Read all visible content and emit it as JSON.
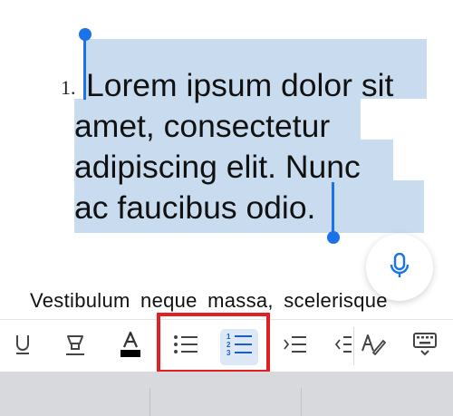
{
  "editor": {
    "list_number": "1.",
    "list_lines": [
      "Lorem ipsum dolor sit",
      "amet, consectetur",
      "adipiscing elit. Nunc",
      "ac faucibus odio."
    ],
    "paragraph": "Vestibulum neque massa, scelerisque"
  },
  "toolbar": {
    "buttons": [
      {
        "name": "underline-icon",
        "active": false
      },
      {
        "name": "highlighter-icon",
        "active": false
      },
      {
        "name": "font-color-icon",
        "active": false
      },
      {
        "name": "bulleted-list-icon",
        "active": false
      },
      {
        "name": "numbered-list-icon",
        "active": true
      },
      {
        "name": "increase-indent-icon",
        "active": false
      },
      {
        "name": "decrease-indent-icon",
        "active": false
      },
      {
        "name": "draw-icon",
        "active": false
      },
      {
        "name": "keyboard-dismiss-icon",
        "active": false
      }
    ]
  },
  "colors": {
    "selection": "#c9dcef",
    "handle": "#1a73e8",
    "accent_active": "#dce7f7",
    "annotation_box": "#e22024"
  }
}
